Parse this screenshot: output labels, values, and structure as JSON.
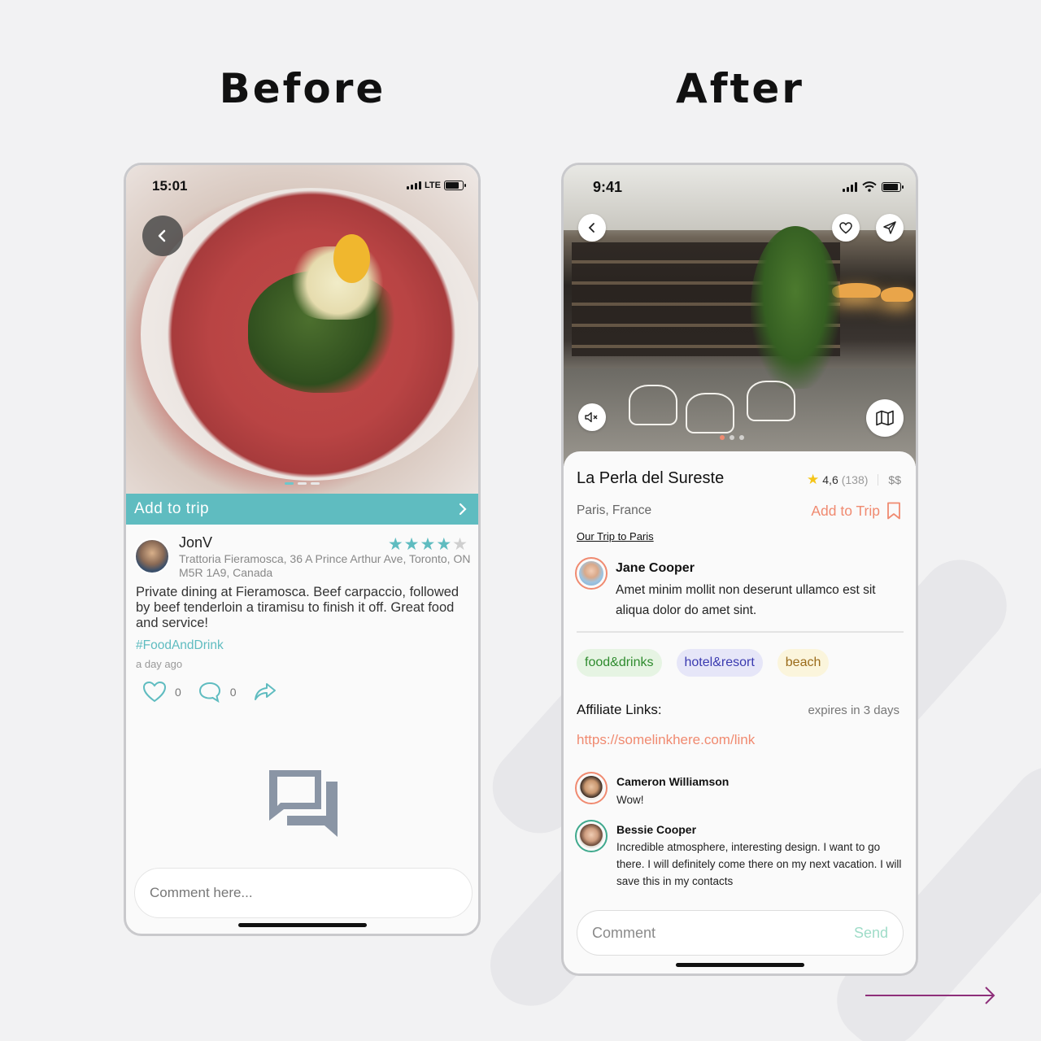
{
  "headings": {
    "before": "Before",
    "after": "After"
  },
  "before": {
    "status": {
      "time": "15:01",
      "network": "LTE"
    },
    "add_to_trip": "Add to trip",
    "post": {
      "user": "JonV",
      "rating": 4,
      "rating_max": 5,
      "address": "Trattoria Fieramosca, 36 A Prince Arthur Ave, Toronto, ON M5R 1A9, Canada",
      "body": "Private dining at Fieramosca. Beef carpaccio, followed by beef tenderloin a tiramisu to finish it off. Great food and service!",
      "hashtag": "#FoodAndDrink",
      "time_ago": "a day ago",
      "likes": "0",
      "comments": "0"
    },
    "comment_placeholder": "Comment here..."
  },
  "after": {
    "status": {
      "time": "9:41"
    },
    "place": {
      "name": "La Perla del Sureste",
      "rating": "4,6",
      "rating_count": "(138)",
      "price": "$$",
      "location": "Paris, France",
      "add_to_trip": "Add to Trip",
      "trip_link": "Our Trip to Paris"
    },
    "author": {
      "name": "Jane Cooper",
      "text": "Amet minim mollit non deserunt ullamco est sit aliqua dolor do amet sint."
    },
    "tags": [
      {
        "label": "food&drinks",
        "bg": "#e6f4e3",
        "color": "#2e8b2e"
      },
      {
        "label": "hotel&resort",
        "bg": "#e6e6f8",
        "color": "#3a3ab0"
      },
      {
        "label": "beach",
        "bg": "#fbf5dc",
        "color": "#9a6b1a"
      }
    ],
    "affiliate": {
      "label": "Affiliate Links:",
      "expires": "expires in 3 days",
      "link": "https://somelinkhere.com/link"
    },
    "comments": [
      {
        "name": "Cameron Williamson",
        "text": "Wow!"
      },
      {
        "name": "Bessie Cooper",
        "text": "Incredible atmosphere, interesting design. I want to go there. I will definitely come there on my next vacation. I will save this in my contacts"
      }
    ],
    "comment_input": {
      "placeholder": "Comment",
      "send": "Send"
    }
  },
  "colors": {
    "before_accent": "#5fbcc0",
    "after_accent": "#f08a70",
    "send": "#9fdcc8",
    "arrow": "#8e2f7a"
  }
}
